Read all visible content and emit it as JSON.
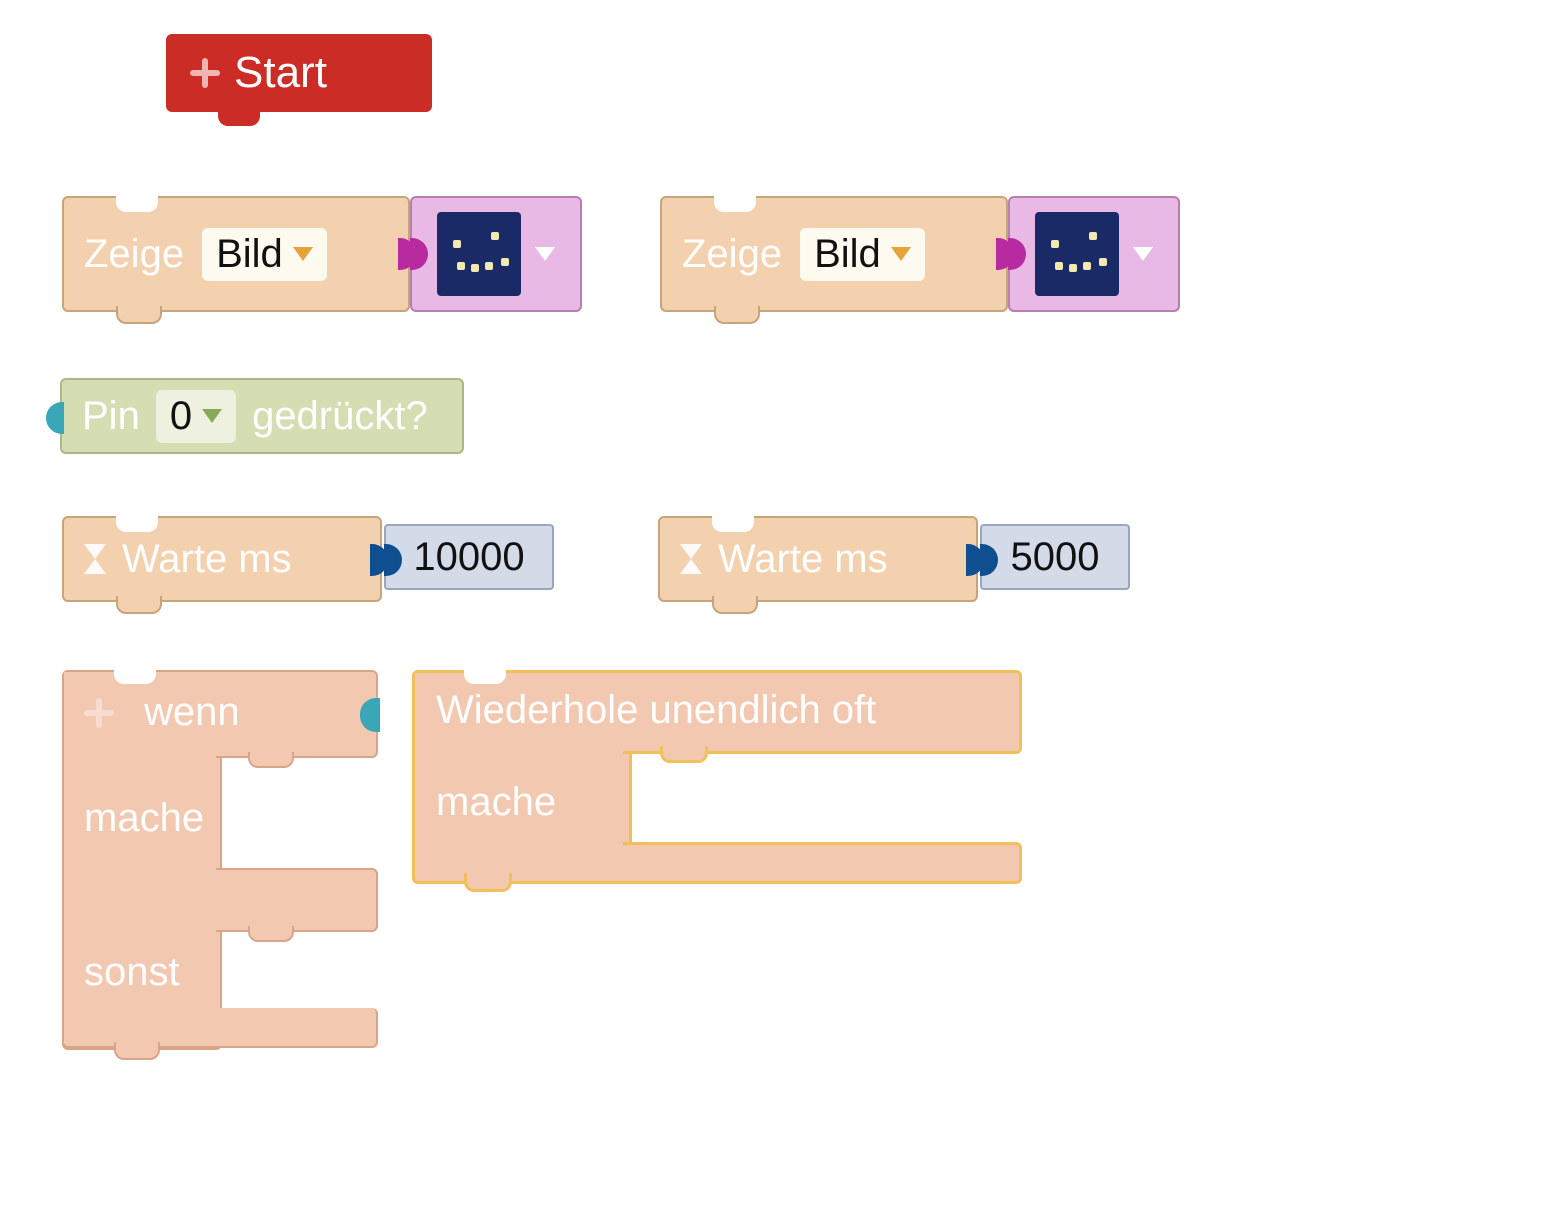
{
  "start": {
    "label": "Start"
  },
  "zeige": {
    "label": "Zeige",
    "dropdown_label": "Bild"
  },
  "pin": {
    "prefix": "Pin",
    "value": "0",
    "suffix": "gedrückt?"
  },
  "warte": {
    "label": "Warte ms",
    "v1": "10000",
    "v2": "5000"
  },
  "ifelse": {
    "if": "wenn",
    "do": "mache",
    "else": "sonst"
  },
  "loop": {
    "title": "Wiederhole unendlich oft",
    "do": "mache"
  },
  "colors": {
    "start": "#cc2c26",
    "action": "#f3d1af",
    "actionBorder": "#c8a47b",
    "control": "#f2c8b0",
    "controlBorder": "#d9a589",
    "sensor": "#d5deb2",
    "sensorBorder": "#a9b887",
    "imageSlot": "#e9b9e6",
    "imageSlotBorder": "#b77fb0",
    "plugMagenta": "#b72aa0",
    "plugBlue": "#0f4f8f",
    "plugTeal": "#3aa7b8",
    "num": "#d3dae8",
    "selected": "#f2c05a"
  }
}
